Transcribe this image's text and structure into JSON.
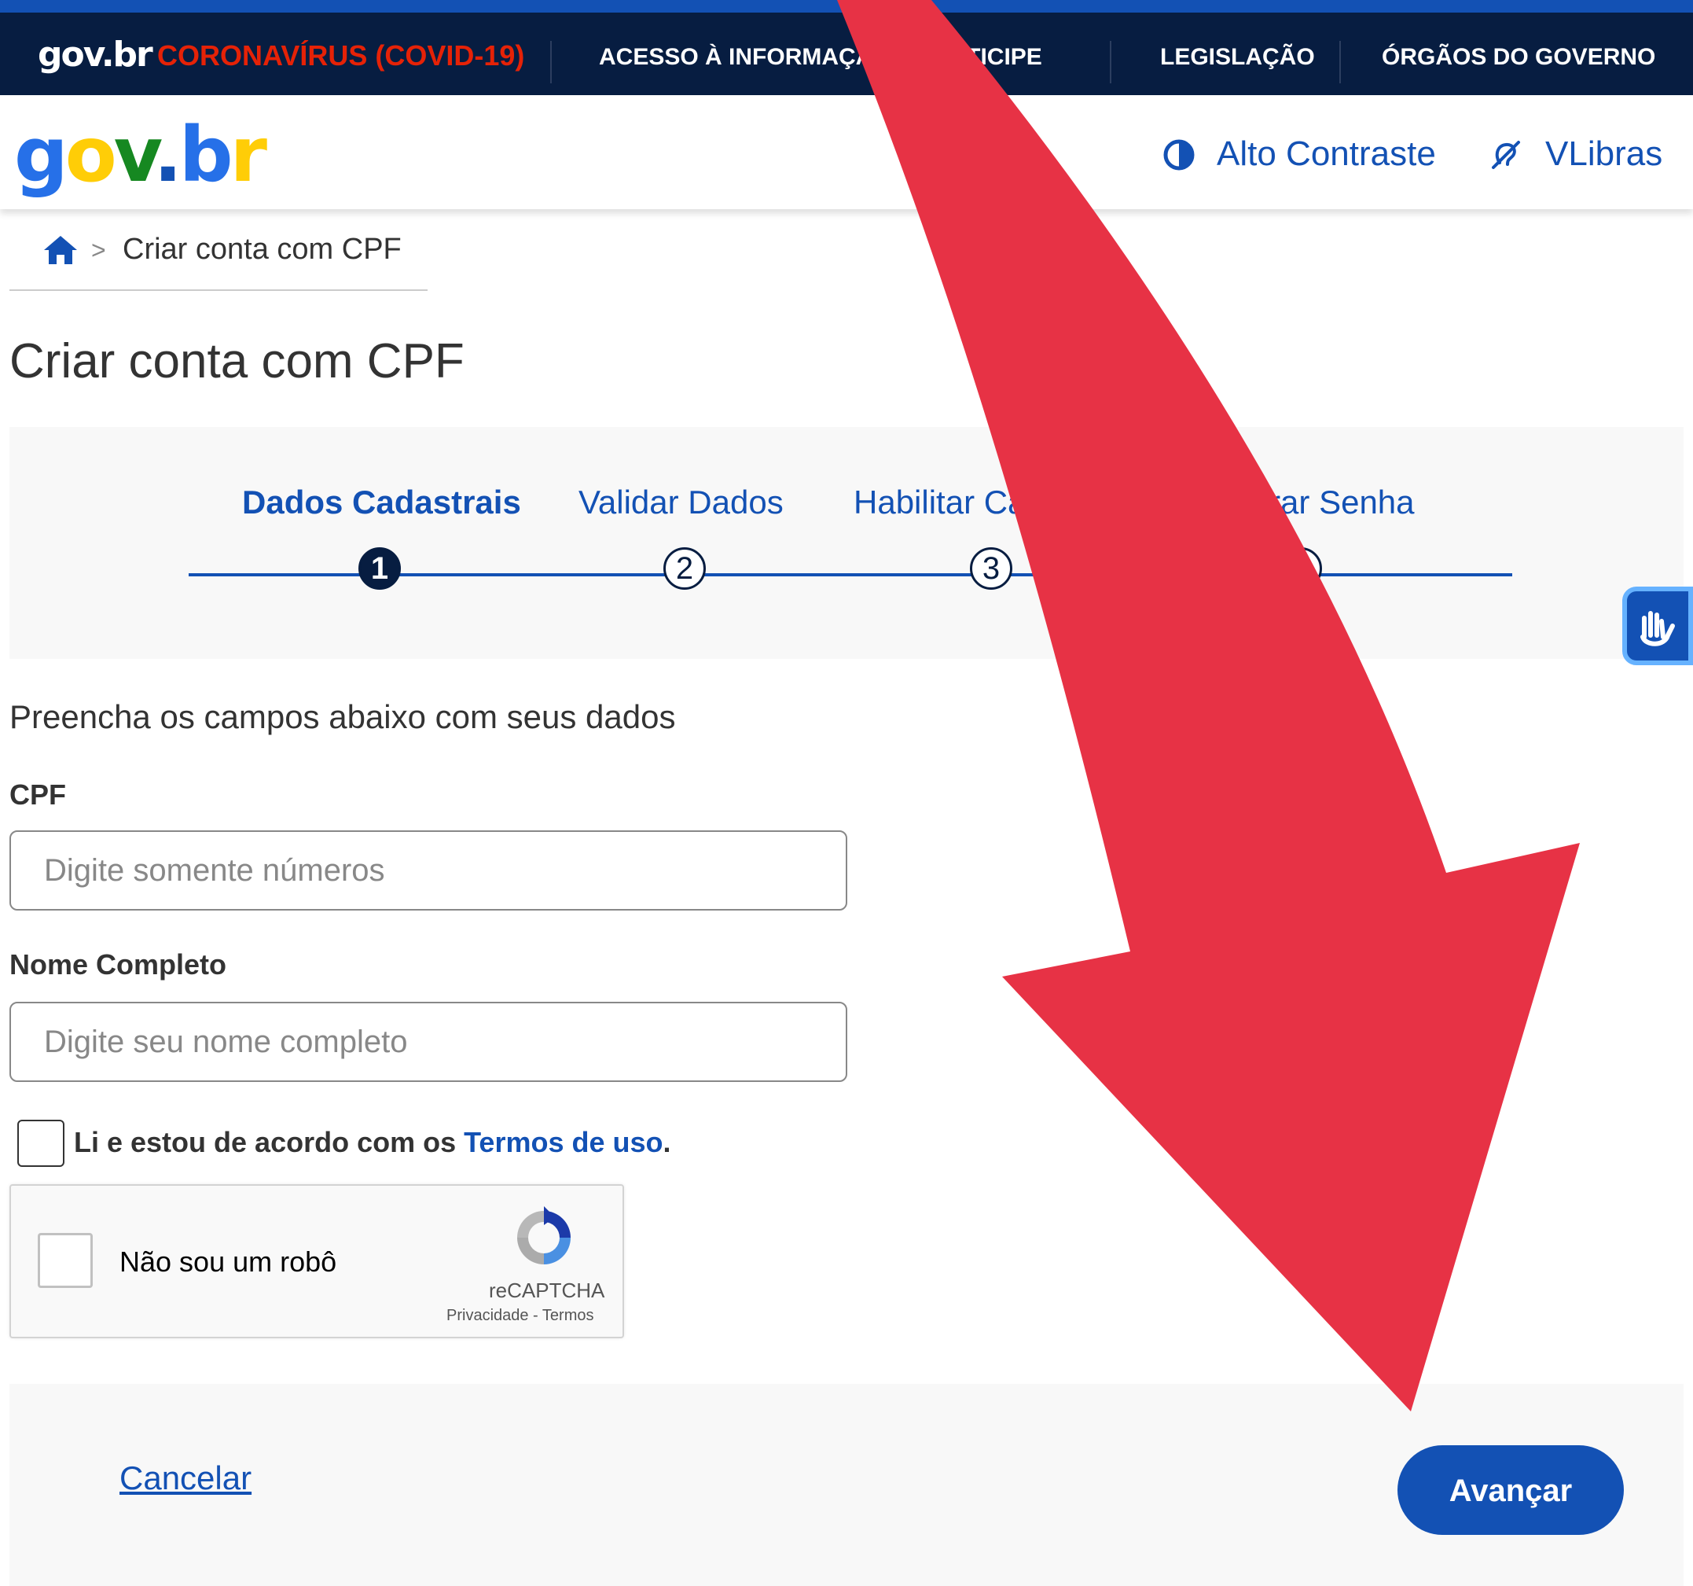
{
  "govbar": {
    "logo": "gov.br",
    "covid": "CORONAVÍRUS (COVID-19)",
    "nav": [
      "ACESSO À INFORMAÇÃO",
      "PARTICIPE",
      "LEGISLAÇÃO",
      "ÓRGÃOS DO GOVERNO"
    ]
  },
  "header": {
    "brand": "gov.br",
    "contrast_label": "Alto Contraste",
    "vlibras_label": "VLibras"
  },
  "breadcrumb": {
    "current": "Criar conta com CPF"
  },
  "page_title": "Criar conta com CPF",
  "stepper": {
    "steps": [
      {
        "label": "Dados Cadastrais",
        "number": "1",
        "active": true
      },
      {
        "label": "Validar Dados",
        "number": "2",
        "active": false
      },
      {
        "label": "Habilitar Cadastro",
        "number": "3",
        "active": false
      },
      {
        "label": "Cadastrar Senha",
        "number": "4",
        "active": false
      }
    ]
  },
  "form": {
    "intro": "Preencha os campos abaixo com seus dados",
    "cpf_label": "CPF",
    "cpf_placeholder": "Digite somente números",
    "cpf_value": "",
    "name_label": "Nome Completo",
    "name_placeholder": "Digite seu nome completo",
    "name_value": "",
    "terms_prefix": "Li e estou de acordo com os ",
    "terms_link": "Termos de uso",
    "terms_suffix": "."
  },
  "captcha": {
    "label": "Não sou um robô",
    "brand": "reCAPTCHA",
    "links": "Privacidade - Termos"
  },
  "footer": {
    "cancel": "Cancelar",
    "advance": "Avançar"
  },
  "colors": {
    "primary": "#1351b4",
    "dark": "#071d41",
    "covid": "#e52207",
    "arrow": "#e73245"
  }
}
